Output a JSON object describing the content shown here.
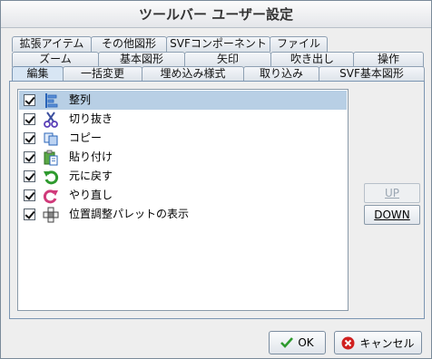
{
  "window": {
    "title": "ツールバー ユーザー設定"
  },
  "tabs": {
    "row1": [
      "拡張アイテム",
      "その他図形",
      "SVFコンポーネント",
      "ファイル"
    ],
    "row2": [
      "ズーム",
      "基本図形",
      "矢印",
      "吹き出し",
      "操作"
    ],
    "row3": [
      "編集",
      "一括変更",
      "埋め込み様式",
      "取り込み",
      "SVF基本図形"
    ],
    "active": "編集"
  },
  "items": [
    {
      "label": "整列",
      "checked": true,
      "selected": true,
      "icon": "align-icon"
    },
    {
      "label": "切り抜き",
      "checked": true,
      "selected": false,
      "icon": "scissors-icon"
    },
    {
      "label": "コピー",
      "checked": true,
      "selected": false,
      "icon": "copy-icon"
    },
    {
      "label": "貼り付け",
      "checked": true,
      "selected": false,
      "icon": "paste-icon"
    },
    {
      "label": "元に戻す",
      "checked": true,
      "selected": false,
      "icon": "undo-icon"
    },
    {
      "label": "やり直し",
      "checked": true,
      "selected": false,
      "icon": "redo-icon"
    },
    {
      "label": "位置調整パレットの表示",
      "checked": true,
      "selected": false,
      "icon": "position-palette-icon"
    }
  ],
  "side_buttons": {
    "up": "UP",
    "down": "DOWN",
    "up_enabled": false
  },
  "footer": {
    "ok": "OK",
    "cancel": "キャンセル"
  },
  "colors": {
    "selection": "#b8cfe5",
    "active_tab": "#d8e6f4",
    "ok_check": "#2e9a2e",
    "cancel_x": "#d02020"
  }
}
